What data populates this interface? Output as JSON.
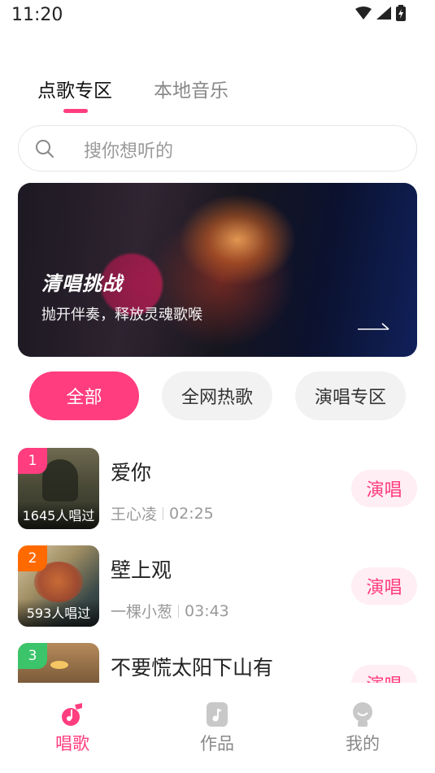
{
  "status_bar": {
    "time": "11:20"
  },
  "tabs": [
    {
      "label": "点歌专区"
    },
    {
      "label": "本地音乐"
    }
  ],
  "search": {
    "placeholder": "搜你想听的"
  },
  "banner": {
    "title": "清唱挑战",
    "subtitle": "抛开伴奏，释放灵魂歌喉"
  },
  "chips": [
    {
      "label": "全部"
    },
    {
      "label": "全网热歌"
    },
    {
      "label": "演唱专区"
    }
  ],
  "songs": [
    {
      "rank": "1",
      "title": "爱你",
      "artist": "王心凌",
      "duration": "02:25",
      "plays": "1645人唱过",
      "action": "演唱"
    },
    {
      "rank": "2",
      "title": "壁上观",
      "artist": "一棵小葱",
      "duration": "03:43",
      "plays": "593人唱过",
      "action": "演唱"
    },
    {
      "rank": "3",
      "title": "不要慌太阳下山有",
      "artist": "",
      "duration": "",
      "plays": "",
      "action": "演唱"
    }
  ],
  "bottom_nav": [
    {
      "label": "唱歌"
    },
    {
      "label": "作品"
    },
    {
      "label": "我的"
    }
  ],
  "colors": {
    "accent": "#ff3d7f",
    "accent_light": "#ffeef3",
    "muted": "#999999"
  }
}
